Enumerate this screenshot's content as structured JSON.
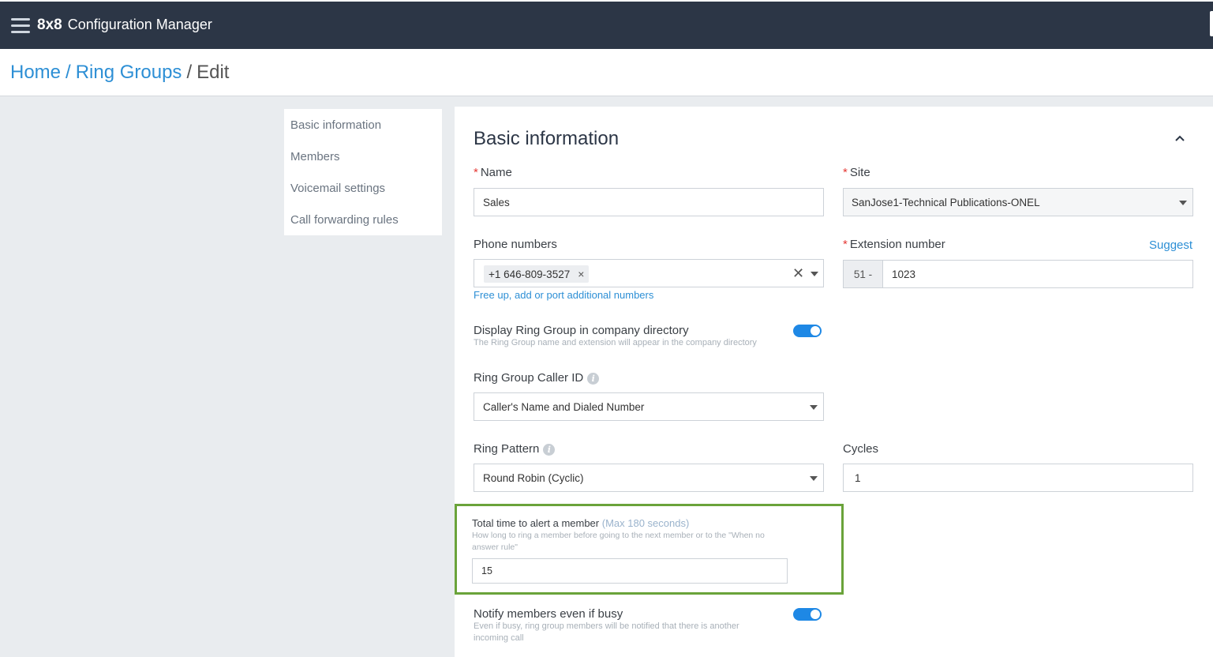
{
  "header": {
    "brand_bold": "8x8",
    "brand_text": "Configuration Manager"
  },
  "breadcrumb": {
    "home": "Home",
    "sep1": "/",
    "ring_groups": "Ring Groups",
    "sep2": "/",
    "current": "Edit"
  },
  "sidenav": {
    "items": [
      "Basic information",
      "Members",
      "Voicemail settings",
      "Call forwarding rules"
    ]
  },
  "form": {
    "title": "Basic information",
    "name": {
      "label": "Name",
      "required": "*",
      "value": "Sales"
    },
    "site": {
      "label": "Site",
      "required": "*",
      "value": "SanJose1-Technical Publications-ONEL"
    },
    "phone_numbers": {
      "label": "Phone numbers",
      "chip": "+1 646-809-3527",
      "chip_remove": "×",
      "clear": "✕",
      "link": "Free up, add or port additional numbers"
    },
    "extension": {
      "label": "Extension number",
      "required": "*",
      "suggest": "Suggest",
      "prefix": "51 -",
      "value": "1023"
    },
    "directory": {
      "label": "Display Ring Group in company directory",
      "hint": "The Ring Group name and extension will appear in the company directory",
      "enabled": true
    },
    "caller_id": {
      "label": "Ring Group Caller ID",
      "info": "i",
      "value": "Caller's Name and Dialed Number"
    },
    "ring_pattern": {
      "label": "Ring Pattern",
      "info": "i",
      "value": "Round Robin (Cyclic)"
    },
    "cycles": {
      "label": "Cycles",
      "value": "1"
    },
    "alert_time": {
      "label": "Total time to alert a member",
      "max": "(Max 180 seconds)",
      "hint": "How long to ring a member before going to the next member or to the \"When no answer rule\"",
      "value": "15"
    },
    "notify_busy": {
      "label": "Notify members even if busy",
      "hint": "Even if busy, ring group members will be notified that there is another incoming call",
      "enabled": true
    }
  },
  "colors": {
    "topbar": "#2c3646",
    "accent": "#2d8fd5",
    "toggle": "#1e88e5",
    "highlight": "#6aa33a",
    "required": "#e53935"
  }
}
